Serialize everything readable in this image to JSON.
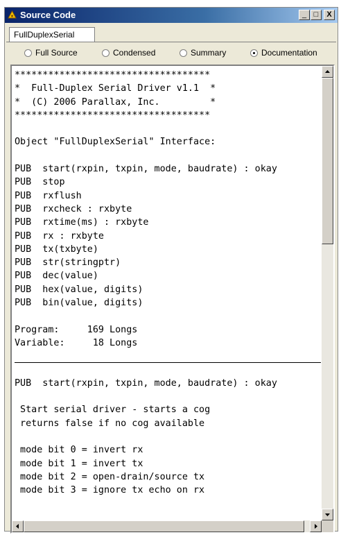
{
  "window": {
    "title": "Source Code",
    "tab": "FullDuplexSerial",
    "controls": {
      "minimize": "_",
      "maximize": "□",
      "close": "X"
    }
  },
  "view_modes": [
    {
      "label": "Full Source",
      "checked": false
    },
    {
      "label": "Condensed",
      "checked": false
    },
    {
      "label": "Summary",
      "checked": false
    },
    {
      "label": "Documentation",
      "checked": true
    }
  ],
  "code_lines": [
    "***********************************",
    "*  Full-Duplex Serial Driver v1.1  *",
    "*  (C) 2006 Parallax, Inc.         *",
    "***********************************",
    "",
    "Object \"FullDuplexSerial\" Interface:",
    "",
    "PUB  start(rxpin, txpin, mode, baudrate) : okay",
    "PUB  stop",
    "PUB  rxflush",
    "PUB  rxcheck : rxbyte",
    "PUB  rxtime(ms) : rxbyte",
    "PUB  rx : rxbyte",
    "PUB  tx(txbyte)",
    "PUB  str(stringptr)",
    "PUB  dec(value)",
    "PUB  hex(value, digits)",
    "PUB  bin(value, digits)",
    "",
    "Program:     169 Longs",
    "Variable:     18 Longs",
    "",
    "",
    "PUB  start(rxpin, txpin, mode, baudrate) : okay",
    "",
    " Start serial driver - starts a cog",
    " returns false if no cog available",
    "",
    " mode bit 0 = invert rx",
    " mode bit 1 = invert tx",
    " mode bit 2 = open-drain/source tx",
    " mode bit 3 = ignore tx echo on rx"
  ],
  "scroll": {
    "vertical_position": 0.0,
    "horizontal_position": 0.0
  },
  "colors": {
    "title_bar": "#0a246a",
    "panel": "#ece9d8",
    "editor_bg": "#ffffff"
  },
  "icons": {
    "title": "app-icon",
    "up": "arrow-up-icon",
    "down": "arrow-down-icon",
    "left": "arrow-left-icon",
    "right": "arrow-right-icon"
  }
}
